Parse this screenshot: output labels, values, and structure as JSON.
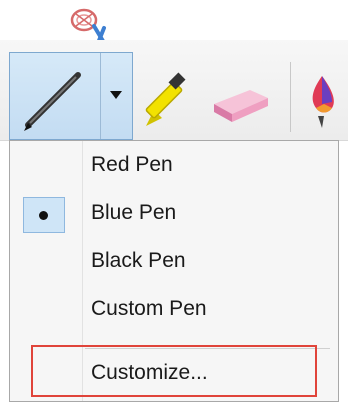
{
  "toolbar": {
    "tools": [
      {
        "name": "pen",
        "icon": "pen-icon",
        "selected": true
      },
      {
        "name": "highlighter",
        "icon": "highlighter-icon"
      },
      {
        "name": "eraser",
        "icon": "eraser-icon"
      },
      {
        "name": "color",
        "icon": "color-drop-icon"
      }
    ],
    "attachment_icon": "scissors-icon"
  },
  "pen_menu": {
    "items": [
      {
        "label": "Red Pen",
        "checked": false
      },
      {
        "label": "Blue Pen",
        "checked": true
      },
      {
        "label": "Black Pen",
        "checked": false
      },
      {
        "label": "Custom Pen",
        "checked": false
      }
    ],
    "customize_label": "Customize..."
  },
  "colors": {
    "selection_bg": "#cfe5f7",
    "highlight_border": "#e0443a",
    "highlighter_yellow": "#f2e200",
    "eraser_pink": "#ef9fc1"
  }
}
